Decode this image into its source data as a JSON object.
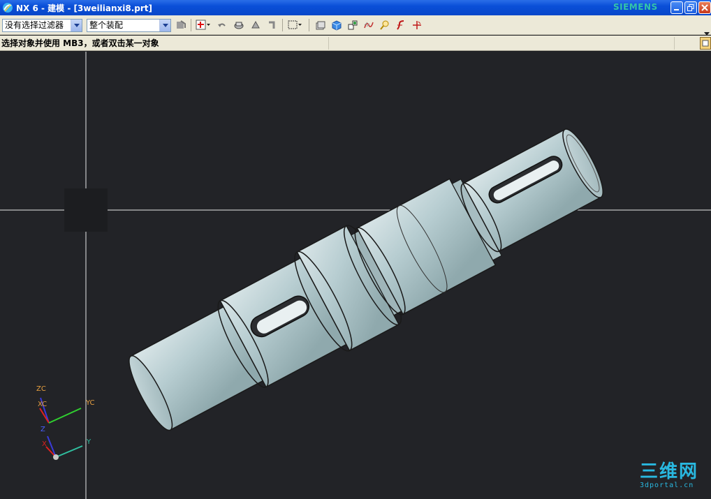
{
  "window": {
    "title": "NX 6 - 建模 - [3weilianxi8.prt]",
    "brand": "SIEMENS"
  },
  "toolbar": {
    "filter_select": "没有选择过滤器",
    "scope_select": "整个装配"
  },
  "status": {
    "prompt": "选择对象并使用 MB3，或者双击某一对象"
  },
  "triads": {
    "wcs": {
      "z": "ZC",
      "x": "XC",
      "y": "YC"
    },
    "absolute": {
      "z": "Z",
      "x": "X",
      "y": "Y"
    }
  },
  "watermark": {
    "main": "三维网",
    "sub": "3dportal.cn"
  },
  "colors": {
    "titlebar": "#0a4fd8",
    "brand": "#34c4a8",
    "viewport_bg": "#222327",
    "shaft": "#b7cdd1",
    "watermark": "#29b8e0"
  }
}
